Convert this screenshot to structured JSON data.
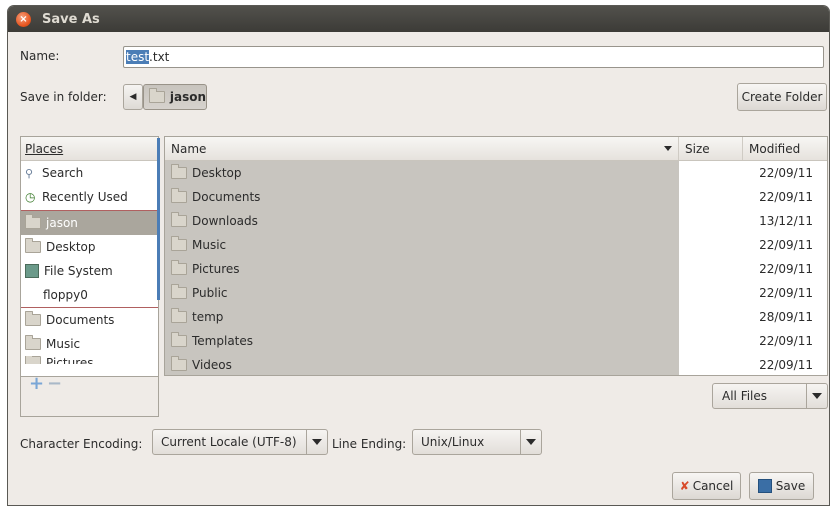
{
  "window": {
    "title": "Save As"
  },
  "name_field": {
    "label": "Name:",
    "value_selected": "test",
    "value_rest": ".txt"
  },
  "save_in": {
    "label": "Save in folder:",
    "current": "jason",
    "create_folder": "Create Folder"
  },
  "places": {
    "header": "Places",
    "items": [
      {
        "label": "Search",
        "icon": "magnifier-icon"
      },
      {
        "label": "Recently Used",
        "icon": "clock-icon"
      },
      {
        "label": "jason",
        "icon": "folder-icon",
        "selected": true
      },
      {
        "label": "Desktop",
        "icon": "folder-icon"
      },
      {
        "label": "File System",
        "icon": "drive-icon"
      },
      {
        "label": "floppy0",
        "icon": ""
      },
      {
        "label": "Documents",
        "icon": "folder-icon"
      },
      {
        "label": "Music",
        "icon": "folder-icon"
      },
      {
        "label": "Pictures",
        "icon": "folder-icon"
      }
    ],
    "add": "+",
    "remove": "−"
  },
  "files": {
    "columns": {
      "name": "Name",
      "size": "Size",
      "modified": "Modified"
    },
    "rows": [
      {
        "name": "Desktop",
        "modified": "22/09/11"
      },
      {
        "name": "Documents",
        "modified": "22/09/11"
      },
      {
        "name": "Downloads",
        "modified": "13/12/11"
      },
      {
        "name": "Music",
        "modified": "22/09/11"
      },
      {
        "name": "Pictures",
        "modified": "22/09/11"
      },
      {
        "name": "Public",
        "modified": "22/09/11"
      },
      {
        "name": "temp",
        "modified": "28/09/11"
      },
      {
        "name": "Templates",
        "modified": "22/09/11"
      },
      {
        "name": "Videos",
        "modified": "22/09/11"
      }
    ]
  },
  "filter": {
    "value": "All Files"
  },
  "encoding": {
    "label": "Character Encoding:",
    "value": "Current Locale (UTF-8)"
  },
  "line_ending": {
    "label": "Line Ending:",
    "value": "Unix/Linux"
  },
  "buttons": {
    "cancel": "Cancel",
    "save": "Save"
  },
  "colors": {
    "selection": "#4b7db6",
    "titlebar": "#3c3b37",
    "close": "#e6541e",
    "dialog_bg": "#efebe7"
  }
}
